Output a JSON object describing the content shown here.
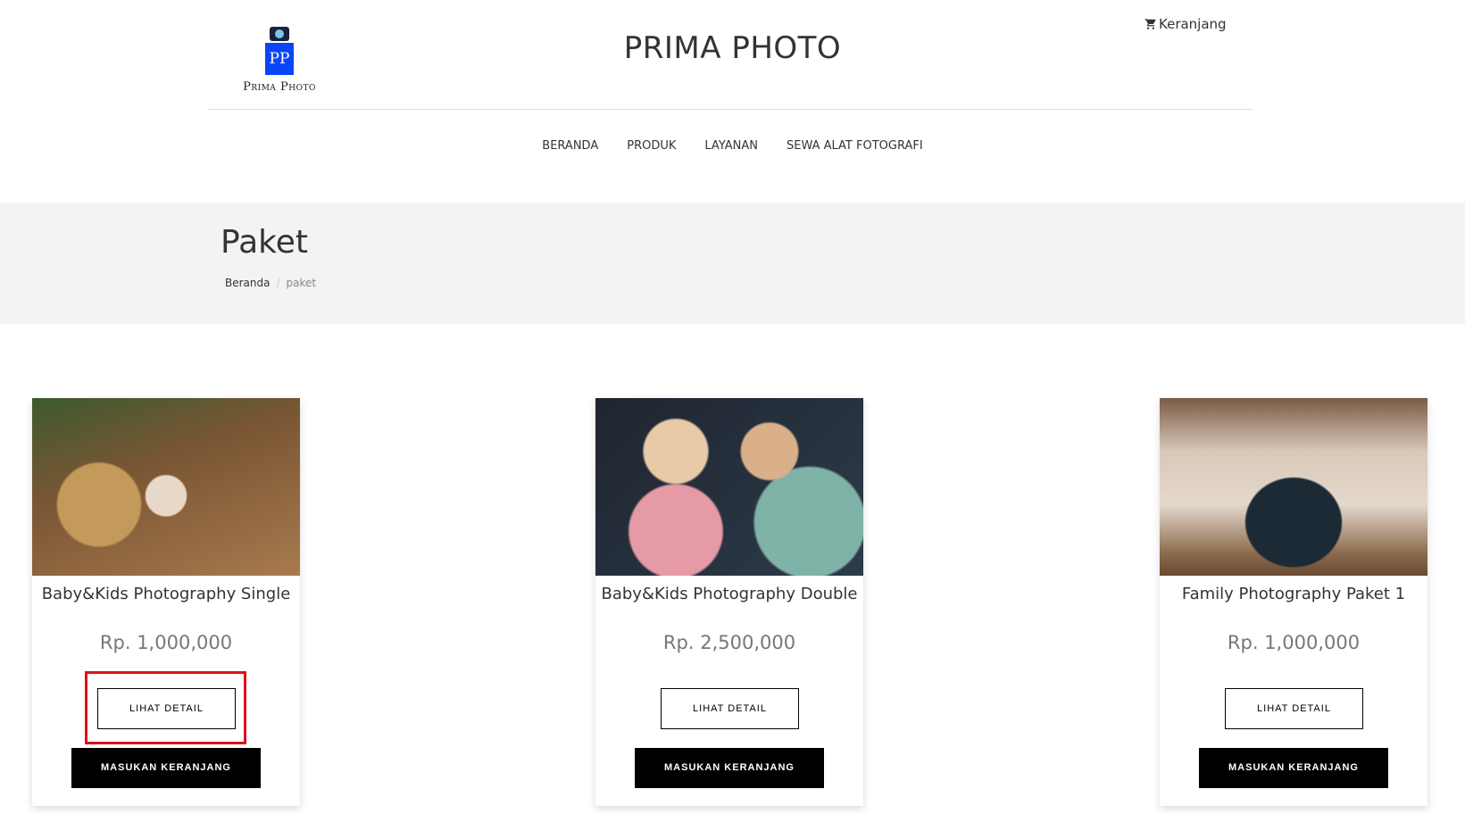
{
  "header": {
    "logo_initials": "PP",
    "logo_text": "Prima Photo",
    "title": "PRIMA PHOTO",
    "cart_label": "Keranjang"
  },
  "nav": [
    "BERANDA",
    "PRODUK",
    "LAYANAN",
    "SEWA ALAT FOTOGRAFI"
  ],
  "page": {
    "title": "Paket",
    "breadcrumb": [
      "Beranda",
      "paket"
    ]
  },
  "products": [
    {
      "name": "Baby&Kids Photography Single",
      "price": "Rp. 1,000,000",
      "detail_label": "LIHAT DETAIL",
      "cart_label": "MASUKAN KERANJANG"
    },
    {
      "name": "Baby&Kids Photography Double",
      "price": "Rp. 2,500,000",
      "detail_label": "LIHAT DETAIL",
      "cart_label": "MASUKAN KERANJANG"
    },
    {
      "name": "Family Photography Paket 1",
      "price": "Rp. 1,000,000",
      "detail_label": "LIHAT DETAIL",
      "cart_label": "MASUKAN KERANJANG"
    }
  ],
  "highlight_color": "#e0101c"
}
